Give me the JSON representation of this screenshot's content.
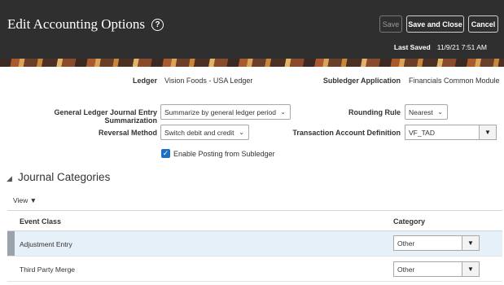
{
  "header": {
    "title": "Edit Accounting Options",
    "help_icon": "?",
    "save_label": "Save",
    "save_and_close_label": "Save and Close",
    "cancel_label": "Cancel",
    "last_saved_label": "Last Saved",
    "last_saved_value": "11/9/21 7:51 AM"
  },
  "form": {
    "ledger_label": "Ledger",
    "ledger_value": "Vision Foods - USA Ledger",
    "subledger_app_label": "Subledger Application",
    "subledger_app_value": "Financials Common Module",
    "gl_summarization_label": "General Ledger Journal Entry Summarization",
    "gl_summarization_value": "Summarize by general ledger period",
    "rounding_rule_label": "Rounding Rule",
    "rounding_rule_value": "Nearest",
    "reversal_method_label": "Reversal Method",
    "reversal_method_value": "Switch debit and credit",
    "tad_label": "Transaction Account Definition",
    "tad_value": "VF_TAD",
    "enable_posting_label": "Enable Posting from Subledger",
    "enable_posting_checked": true
  },
  "journal_categories": {
    "title": "Journal Categories",
    "view_label": "View",
    "columns": {
      "event_class": "Event Class",
      "category": "Category"
    },
    "rows": [
      {
        "event_class": "Adjustment Entry",
        "category": "Other",
        "selected": true
      },
      {
        "event_class": "Third Party Merge",
        "category": "Other",
        "selected": false
      }
    ]
  },
  "colors": {
    "header_bg": "#2f2f2f",
    "selected_row": "#e6f0f8",
    "checkbox": "#1b6fc4"
  }
}
